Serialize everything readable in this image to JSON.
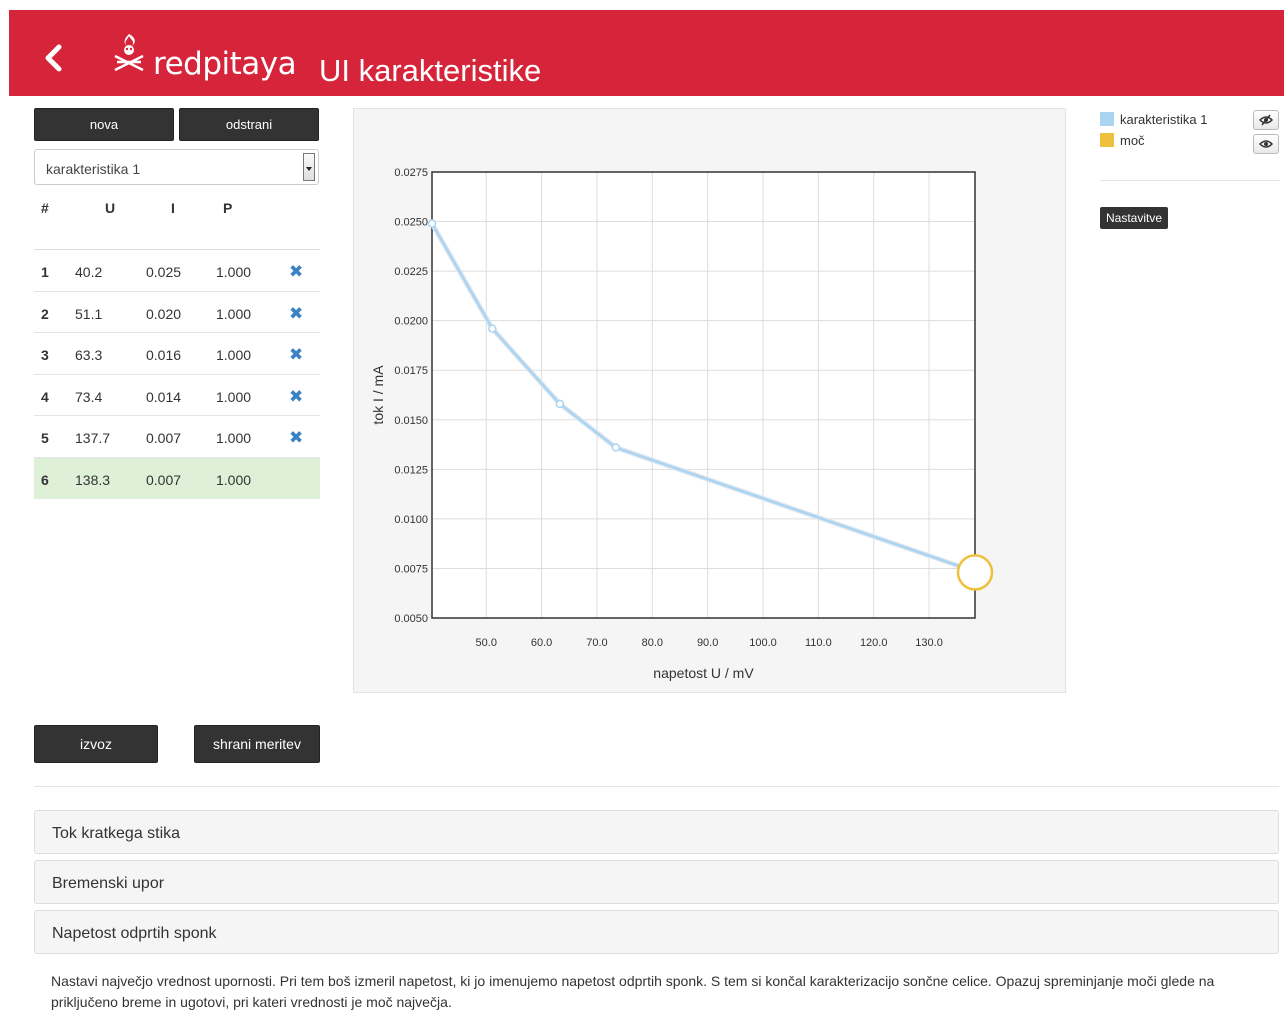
{
  "header": {
    "brand": "redpitaya",
    "title": "UI karakteristike"
  },
  "controls": {
    "new_label": "nova",
    "remove_label": "odstrani",
    "selected_characteristic": "karakteristika 1",
    "export_label": "izvoz",
    "save_label": "shrani meritev"
  },
  "table": {
    "headers": [
      "#",
      "U",
      "I",
      "P"
    ],
    "rows": [
      {
        "n": "1",
        "u": "40.2",
        "i": "0.025",
        "p": "1.000"
      },
      {
        "n": "2",
        "u": "51.1",
        "i": "0.020",
        "p": "1.000"
      },
      {
        "n": "3",
        "u": "63.3",
        "i": "0.016",
        "p": "1.000"
      },
      {
        "n": "4",
        "u": "73.4",
        "i": "0.014",
        "p": "1.000"
      },
      {
        "n": "5",
        "u": "137.7",
        "i": "0.007",
        "p": "1.000"
      },
      {
        "n": "6",
        "u": "138.3",
        "i": "0.007",
        "p": "1.000"
      }
    ],
    "delete_icon": "✖"
  },
  "legend": {
    "items": [
      {
        "label": "karakteristika 1",
        "color": "#aad4f2"
      },
      {
        "label": "moč",
        "color": "#efc03c"
      }
    ],
    "settings_label": "Nastavitve"
  },
  "chart_data": {
    "type": "line",
    "xlabel": "napetost U / mV",
    "ylabel": "tok I / mA",
    "xlim": [
      40.2,
      138.3
    ],
    "ylim": [
      0.005,
      0.0275
    ],
    "xticks": [
      "50.0",
      "60.0",
      "70.0",
      "80.0",
      "90.0",
      "100.0",
      "110.0",
      "120.0",
      "130.0"
    ],
    "yticks": [
      "0.0050",
      "0.0075",
      "0.0100",
      "0.0125",
      "0.0150",
      "0.0175",
      "0.0200",
      "0.0225",
      "0.0250",
      "0.0275"
    ],
    "grid": true,
    "series": [
      {
        "name": "karakteristika 1",
        "color": "#aad4f2",
        "x": [
          40.2,
          51.1,
          63.3,
          73.4,
          137.7
        ],
        "y": [
          0.0249,
          0.0196,
          0.0158,
          0.0136,
          0.0074
        ]
      }
    ],
    "highlight_point": {
      "x": 138.3,
      "y": 0.0073,
      "color": "#efc03c"
    }
  },
  "accordion": {
    "sections": [
      "Tok kratkega stika",
      "Bremenski upor",
      "Napetost odprtih sponk"
    ],
    "open_text": "Nastavi največjo vrednost upornosti. Pri tem boš izmeril napetost, ki jo imenujemo napetost odprtih sponk. S tem si končal karakterizacijo sončne celice. Opazuj spreminjanje moči glede na priključeno breme in ugotovi, pri kateri vrednosti je moč največja."
  }
}
